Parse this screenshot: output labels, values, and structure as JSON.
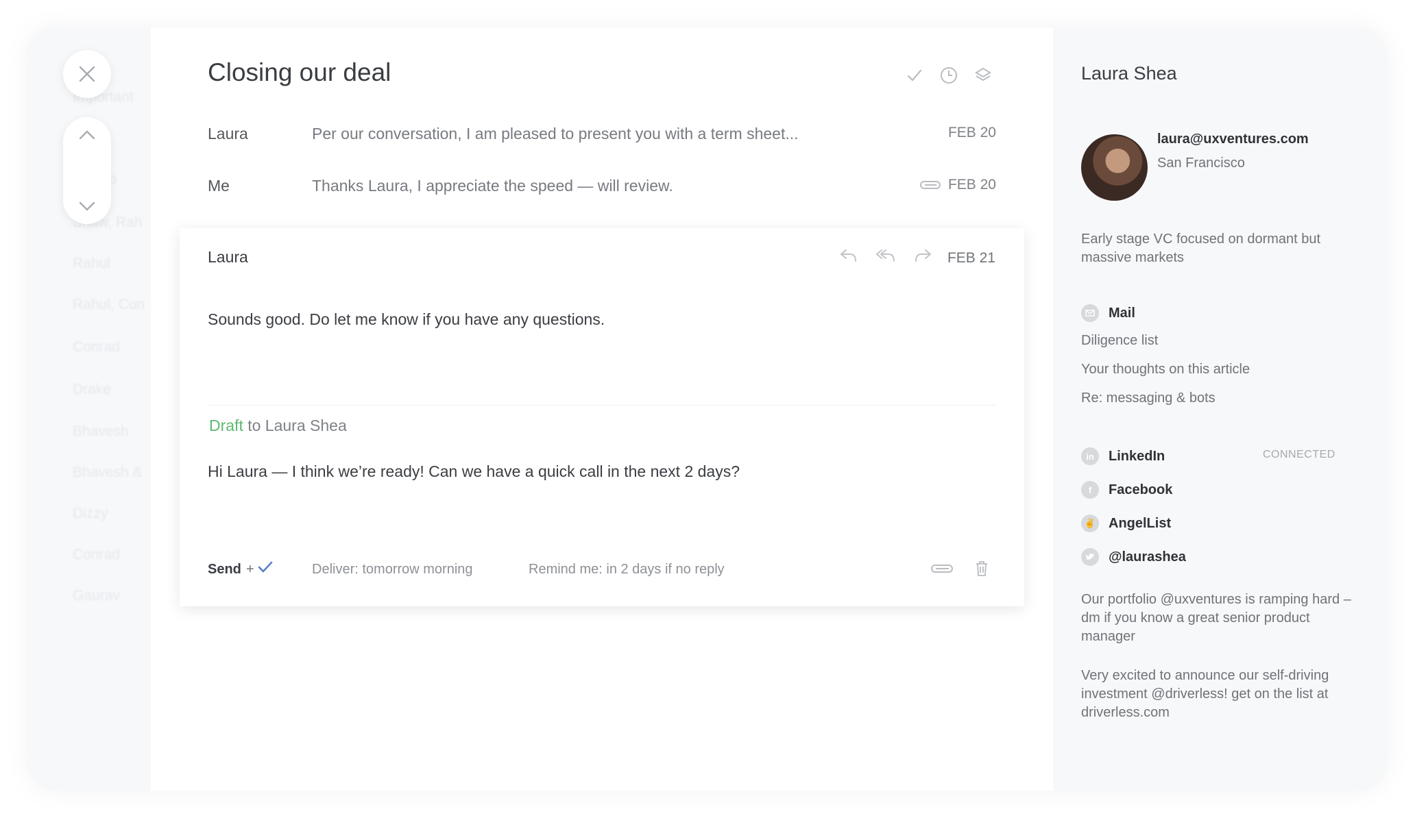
{
  "thread": {
    "title": "Closing our deal",
    "messages": [
      {
        "sender": "Laura",
        "snippet": "Per our conversation, I am pleased to present you with a term sheet...",
        "date": "FEB 20"
      },
      {
        "sender": "Me",
        "snippet": "Thanks Laura, I appreciate the speed — will review.",
        "date": "FEB 20"
      }
    ],
    "open_message": {
      "sender": "Laura",
      "date": "FEB 21",
      "body": "Sounds good.  Do let me know if you have any questions."
    },
    "draft": {
      "label": "Draft",
      "to": " to Laura Shea",
      "body": "Hi Laura — I think we’re ready! Can we have a quick call in the next 2 days?",
      "send_label": "Send",
      "plus": "+",
      "deliver": "Deliver: tomorrow morning",
      "remind": "Remind me: in 2 days if no reply"
    }
  },
  "profile": {
    "name": "Laura Shea",
    "email": "laura@uxventures.com",
    "location": "San Francisco",
    "bio": "Early stage VC focused on dormant but massive markets",
    "mail_section": "Mail",
    "mail_items": [
      "Diligence list",
      "Your thoughts on this article",
      "Re: messaging & bots"
    ],
    "social": {
      "linkedin": "LinkedIn",
      "connected": "CONNECTED",
      "facebook": "Facebook",
      "angellist": "AngelList",
      "twitter": "@laurashea"
    },
    "posts": [
      "Our portfolio @uxventures is ramping hard – dm if you know a great senior product manager",
      "Very excited to announce our self-driving investment @driverless! get on the list at driverless.com"
    ]
  },
  "colors": {
    "accent_green": "#5fb86f",
    "accent_blue": "#5b7fc6"
  }
}
